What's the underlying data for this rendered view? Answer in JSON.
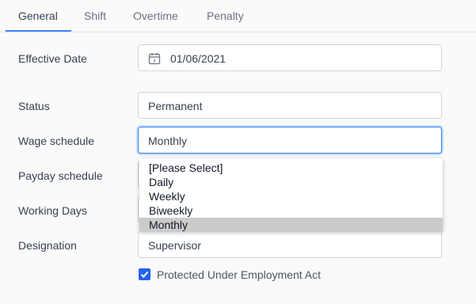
{
  "tabs": [
    {
      "label": "General"
    },
    {
      "label": "Shift"
    },
    {
      "label": "Overtime"
    },
    {
      "label": "Penalty"
    }
  ],
  "form": {
    "effective_date": {
      "label": "Effective Date",
      "value": "01/06/2021",
      "icon": "calendar-icon"
    },
    "status": {
      "label": "Status",
      "value": "Permanent"
    },
    "wage_schedule": {
      "label": "Wage schedule",
      "value": "Monthly"
    },
    "payday_schedule": {
      "label": "Payday schedule"
    },
    "working_days": {
      "label": "Working Days"
    },
    "designation": {
      "label": "Designation",
      "value": "Supervisor"
    },
    "protected": {
      "label": "Protected Under Employment Act",
      "checked": true
    }
  },
  "dropdown": {
    "options": [
      "[Please Select]",
      "Daily",
      "Weekly",
      "Biweekly",
      "Monthly"
    ],
    "selected": "Monthly"
  },
  "colors": {
    "accent": "#3b82f6",
    "checkbox": "#2563eb",
    "selected_option": "#cbcbcb"
  }
}
